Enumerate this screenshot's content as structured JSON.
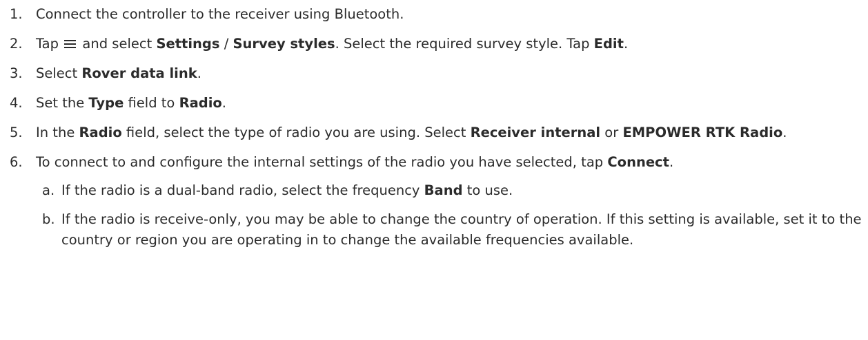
{
  "steps": [
    {
      "num": "1.",
      "parts": [
        "Connect the controller to the receiver using Bluetooth."
      ]
    },
    {
      "num": "2.",
      "parts": [
        "Tap ",
        " and select ",
        "Settings",
        " / ",
        "Survey styles",
        ". Select the required survey style. Tap ",
        "Edit",
        "."
      ],
      "icon": "hamburger-menu-icon"
    },
    {
      "num": "3.",
      "parts": [
        "Select ",
        "Rover data link",
        "."
      ]
    },
    {
      "num": "4.",
      "parts": [
        "Set the ",
        "Type",
        " field to ",
        "Radio",
        "."
      ]
    },
    {
      "num": "5.",
      "parts": [
        "In the ",
        "Radio",
        " field, select the type of radio you are using. Select ",
        "Receiver internal",
        " or ",
        "EMPOWER RTK Radio",
        "."
      ]
    },
    {
      "num": "6.",
      "parts": [
        "To connect to and configure the internal settings of the radio you have selected, tap ",
        "Connect",
        "."
      ],
      "substeps": [
        {
          "num": "a.",
          "parts": [
            "If the radio is a dual-band radio, select the frequency ",
            "Band",
            " to use."
          ]
        },
        {
          "num": "b.",
          "parts": [
            "If the radio is receive-only, you may be able to change the country of operation. If this setting is available, set it to the country or region you are operating in to change the available frequencies available."
          ]
        }
      ]
    }
  ]
}
